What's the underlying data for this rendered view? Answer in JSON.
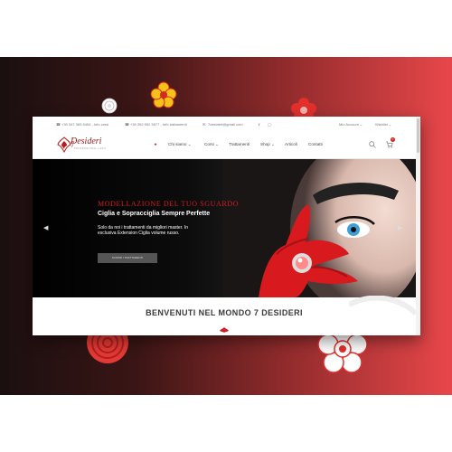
{
  "topbar": {
    "phone1": "+39 347 383 5454 - Info corsi",
    "phone2": "+39 352 552 5577 - Info trattamenti",
    "email": "7desideri@gmail.com",
    "my_account": "Mio Account",
    "wishlist": "Wishlist"
  },
  "logo": {
    "name": "Desideri",
    "number": "7",
    "tagline": "PROFESSIONAL LASH"
  },
  "nav": {
    "items": [
      "Chi siamo",
      "Corsi",
      "Trattamenti",
      "Shop",
      "Articoli",
      "Contatti"
    ],
    "cart_count": "0"
  },
  "hero": {
    "title": "MODELLAZIONE DEL TUO SGUARDO",
    "subtitle": "Ciglia e Sopracciglia Sempre Perfette",
    "description": "Solo da noi i trattamenti da migliori master. In esclusiva Extension Ciglia volume russo.",
    "button": "SCOPRI I TRATTAMENTI"
  },
  "welcome": "BENVENUTI NEL MONDO 7 DESIDERI",
  "colors": {
    "accent": "#d21e22",
    "gradient_dark": "#1b0f10",
    "gradient_light": "#e8474a"
  },
  "icons": [
    "phone-icon",
    "email-icon",
    "facebook-icon",
    "instagram-icon",
    "home-icon",
    "search-icon",
    "cart-icon",
    "chevron-left-icon",
    "chevron-right-icon"
  ]
}
